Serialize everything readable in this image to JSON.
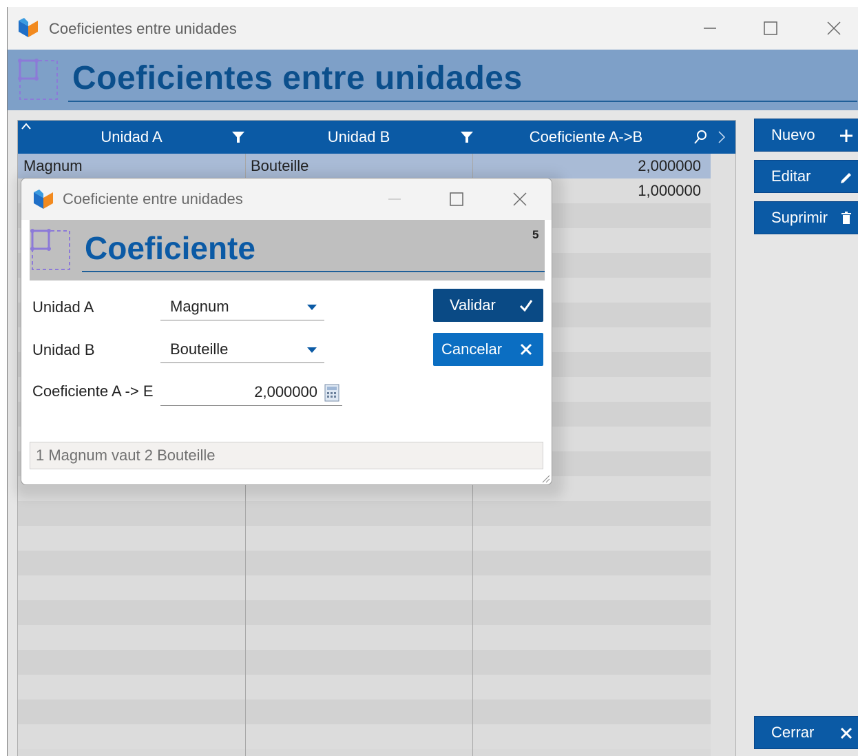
{
  "main_window": {
    "title": "Coeficientes entre unidades",
    "banner_title": "Coeficientes entre unidades",
    "colors": {
      "accent": "#0b5aa5",
      "banner": "#7ea0c8",
      "selected_row": "#a9bbd6"
    }
  },
  "grid": {
    "columns": [
      "Unidad A",
      "Unidad B",
      "Coeficiente A->B"
    ],
    "rows": [
      {
        "unidad_a": "Magnum",
        "unidad_b": "Bouteille",
        "coeficiente": "2,000000",
        "selected": true
      },
      {
        "unidad_a": "",
        "unidad_b": "",
        "coeficiente": "1,000000",
        "selected": false
      }
    ]
  },
  "side_buttons": {
    "nuevo": "Nuevo",
    "editar": "Editar",
    "suprimir": "Suprimir",
    "cerrar": "Cerrar"
  },
  "dialog": {
    "title": "Coeficiente entre unidades",
    "banner_title": "Coeficiente",
    "count": "5",
    "fields": {
      "unidad_a_label": "Unidad A",
      "unidad_a_value": "Magnum",
      "unidad_b_label": "Unidad B",
      "unidad_b_value": "Bouteille",
      "coef_label": "Coeficiente A -> E",
      "coef_value": "2,000000"
    },
    "buttons": {
      "validar": "Validar",
      "cancelar": "Cancelar"
    },
    "info": "1 Magnum vaut 2 Bouteille"
  }
}
